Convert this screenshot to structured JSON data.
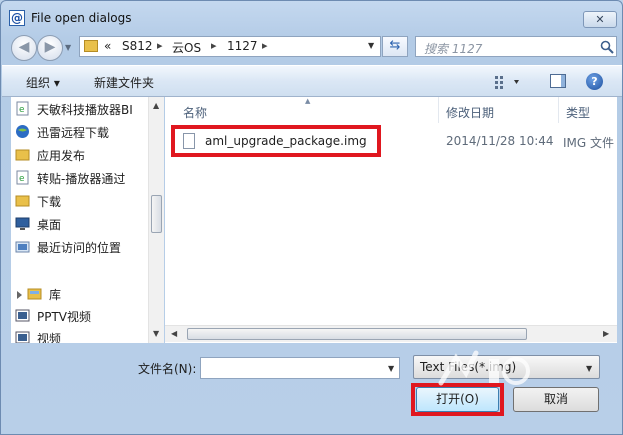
{
  "window": {
    "title": "File open dialogs",
    "close_label": "✕"
  },
  "navigation": {
    "back_glyph": "◀",
    "forward_glyph": "▶"
  },
  "address": {
    "overflow": "«",
    "crumbs": [
      "S812",
      "云OS",
      "1127"
    ]
  },
  "search": {
    "placeholder": "搜索 1127"
  },
  "toolbar": {
    "organize_label": "组织 ▾",
    "new_folder_label": "新建文件夹",
    "help_label": "?"
  },
  "nav_pane": {
    "items": [
      {
        "label": "天敏科技播放器BI",
        "icon": "web-document-icon"
      },
      {
        "label": "迅雷远程下载",
        "icon": "globe-icon"
      },
      {
        "label": "应用发布",
        "icon": "folder-icon"
      },
      {
        "label": "转贴-播放器通过",
        "icon": "web-document-icon"
      },
      {
        "label": "下载",
        "icon": "folder-icon"
      },
      {
        "label": "桌面",
        "icon": "desktop-icon"
      },
      {
        "label": "最近访问的位置",
        "icon": "recent-places-icon"
      },
      {
        "label": "库",
        "icon": "library-icon"
      },
      {
        "label": "PPTV视频",
        "icon": "video-library-icon"
      },
      {
        "label": "视频",
        "icon": "video-library-icon"
      }
    ]
  },
  "file_list": {
    "columns": [
      "名称",
      "修改日期",
      "类型"
    ],
    "rows": [
      {
        "name": "aml_upgrade_package.img",
        "date": "2014/11/28 10:44",
        "type": "IMG 文件"
      }
    ]
  },
  "footer": {
    "filename_label": "文件名(N):",
    "filename_value": "",
    "filter_selected": "Text Files(*.img)",
    "open_label": "打开(O)",
    "cancel_label": "取消"
  },
  "colors": {
    "highlight": "#e0171f",
    "accent": "#2d64b0"
  }
}
